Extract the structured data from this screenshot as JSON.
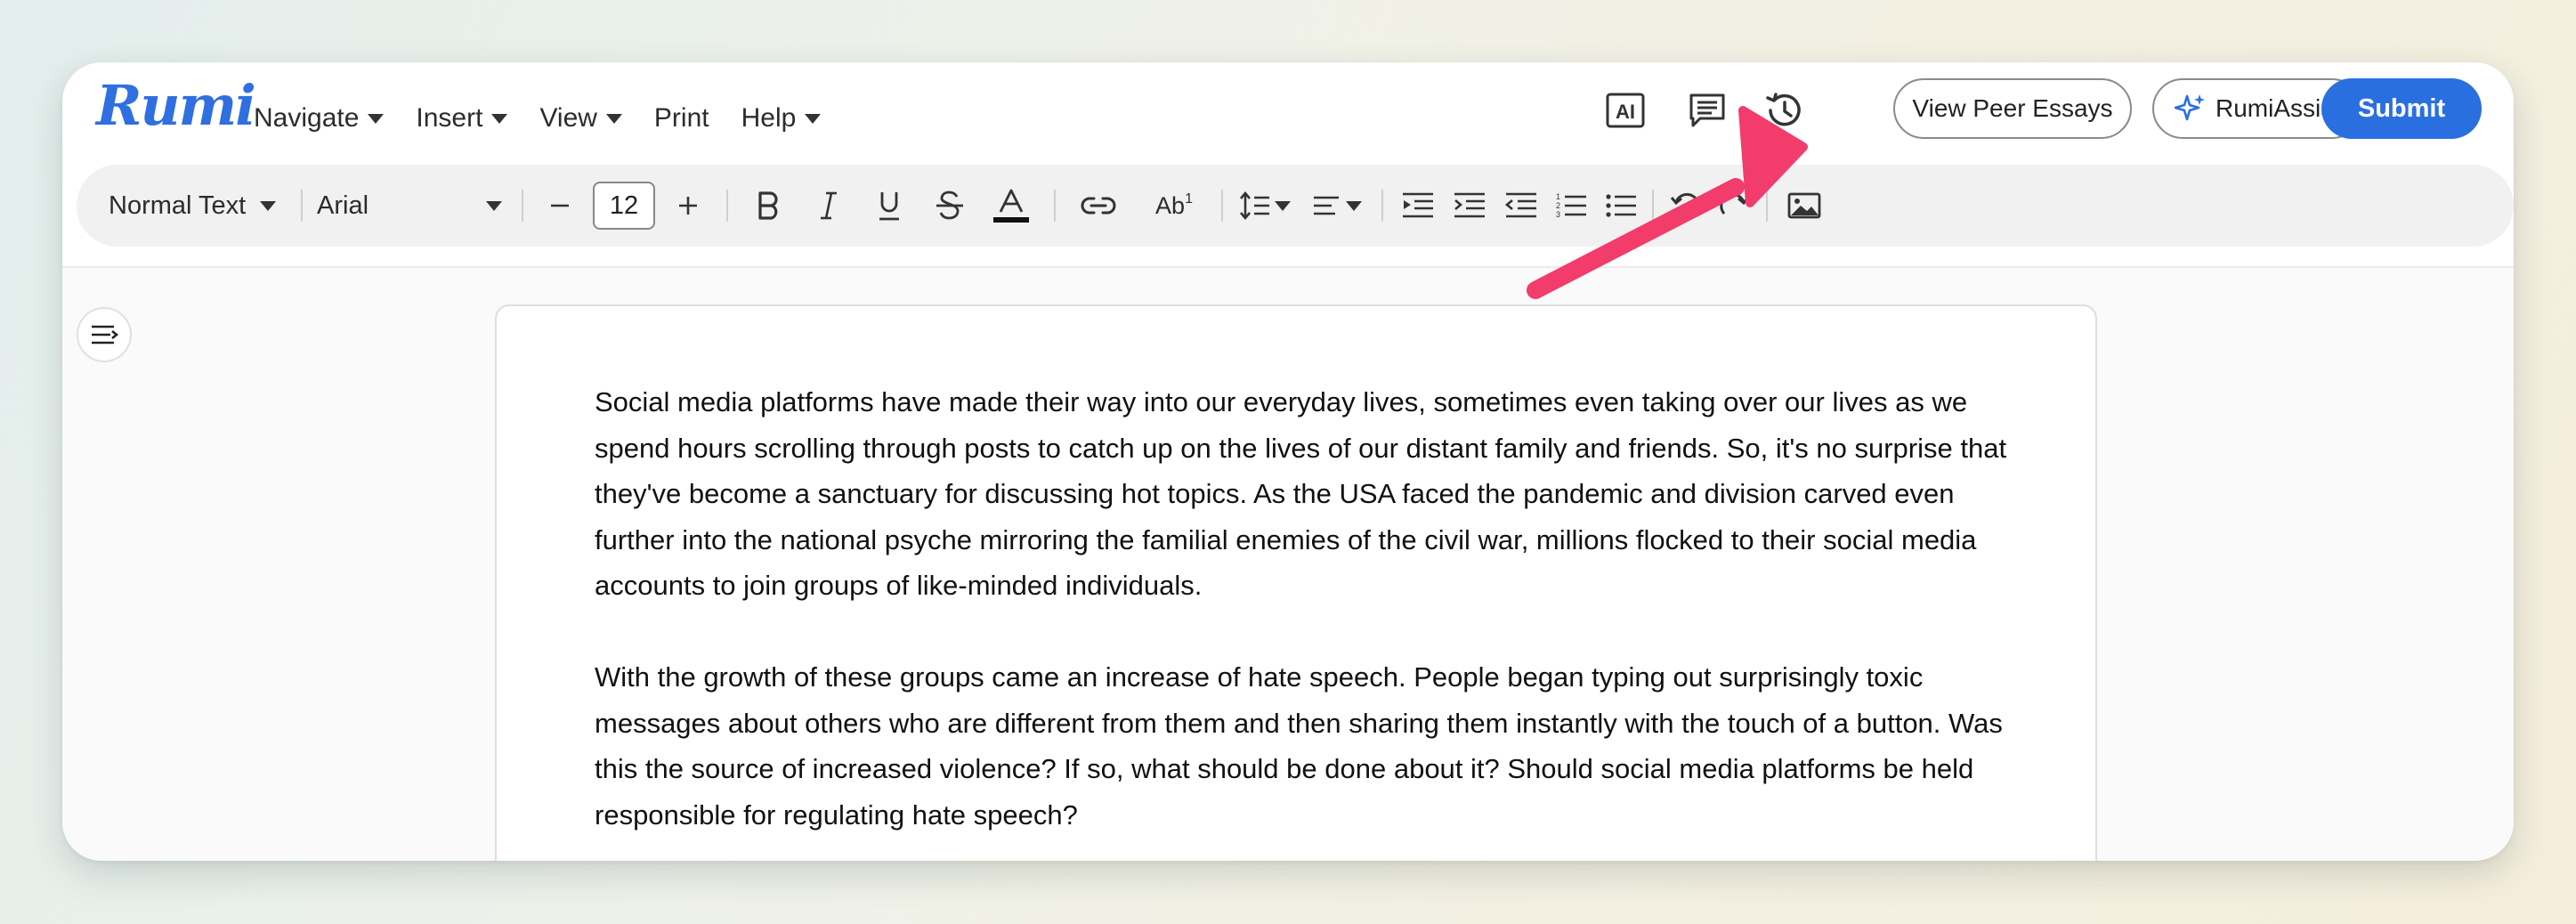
{
  "app": {
    "logo": "Rumi"
  },
  "menu": {
    "items": [
      {
        "label": "Navigate",
        "has_caret": true
      },
      {
        "label": "Insert",
        "has_caret": true
      },
      {
        "label": "View",
        "has_caret": true
      },
      {
        "label": "Print",
        "has_caret": false
      },
      {
        "label": "Help",
        "has_caret": true
      }
    ]
  },
  "header": {
    "ai_icon_label": "AI",
    "view_peer_essays": "View Peer Essays",
    "rumi_assist": "RumiAssist",
    "submit": "Submit"
  },
  "toolbar": {
    "paragraph_style": "Normal Text",
    "font_family": "Arial",
    "font_size": "12",
    "superscript_label": "Ab"
  },
  "document": {
    "paragraphs": [
      "Social media platforms have made their way into our everyday lives, sometimes even taking over our lives as we spend hours scrolling through posts to catch up on the lives of our distant family and friends. So, it's no surprise that they've become a sanctuary for discussing hot topics. As the USA faced the pandemic and division carved even further into the national psyche mirroring the familial enemies of the civil war, millions flocked to their social media accounts to join groups of like-minded individuals.",
      "With the growth of these groups came an increase of hate speech. People began typing out surprisingly toxic messages about others who are different from them and then sharing them instantly with the touch of a button. Was this the source of increased violence? If so, what should be done about it? Should social media platforms be held responsible for regulating hate speech?"
    ]
  },
  "colors": {
    "brand_blue": "#2a6fe0",
    "annotation_arrow": "#f23c6b",
    "background_gradient_start": "#e3eeec",
    "background_gradient_end": "#f5eedd"
  },
  "icons": {
    "ai": "ai-icon",
    "comments": "comment-icon",
    "history": "history-icon",
    "sparkle": "sparkle-icon",
    "outline_toggle": "outline-icon"
  }
}
